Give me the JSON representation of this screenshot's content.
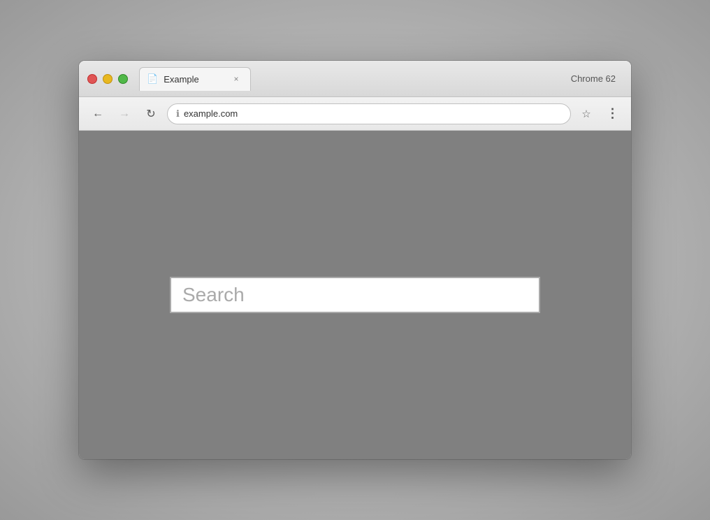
{
  "browser": {
    "chrome_label": "Chrome 62",
    "tab": {
      "title": "Example",
      "icon": "📄"
    },
    "address": {
      "url": "example.com",
      "info_icon": "ℹ"
    },
    "buttons": {
      "back": "←",
      "forward": "→",
      "reload": "↻",
      "star": "☆",
      "menu": "⋮",
      "close": "×"
    }
  },
  "page": {
    "search_placeholder": "Search"
  }
}
